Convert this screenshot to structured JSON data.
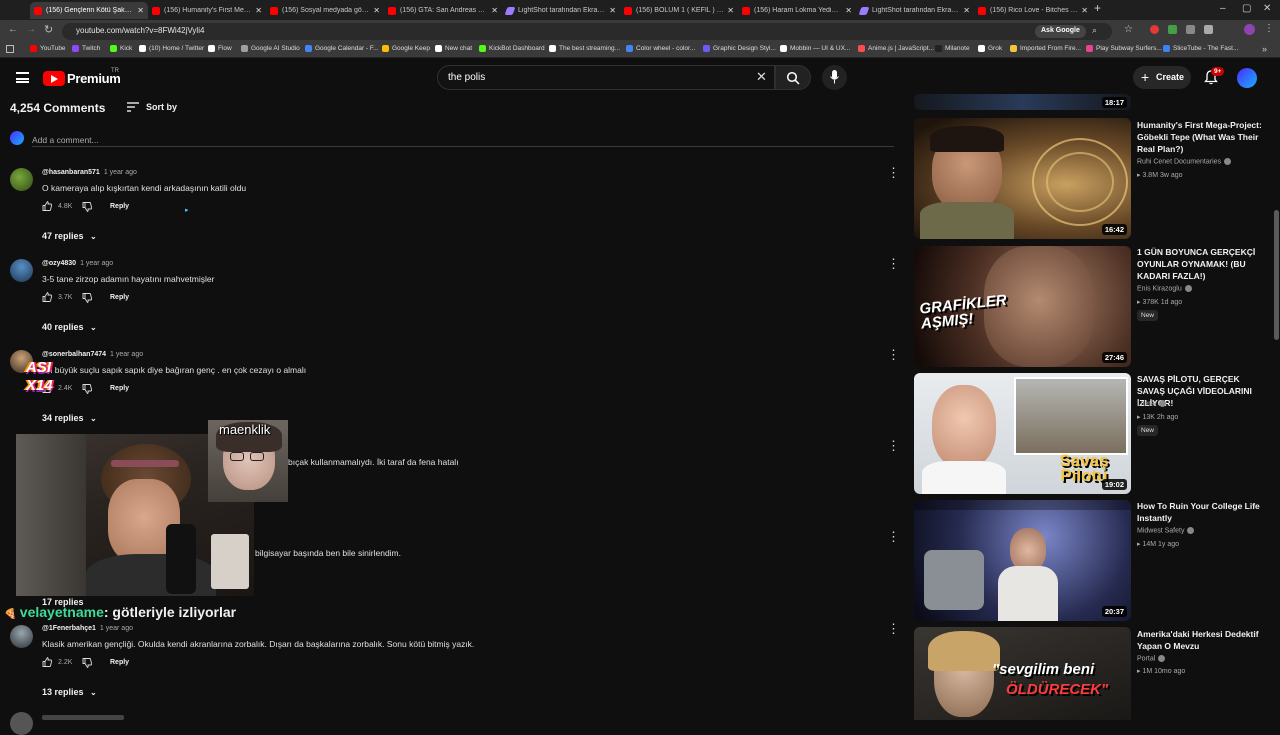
{
  "browser": {
    "tabs": [
      {
        "label": "(156) Gençlerin Kötü Şakası Cin",
        "type": "yt"
      },
      {
        "label": "(156) Humanity's First Mega-Pr",
        "type": "yt"
      },
      {
        "label": "(156) Sosyal medyada gösteriş",
        "type": "yt"
      },
      {
        "label": "(156) GTA: San Andreas Türkçe",
        "type": "yt"
      },
      {
        "label": "LightShot tarafından Ekran Gör",
        "type": "ls"
      },
      {
        "label": "(156) BÖLÜM 1 ( KEFİL ) - YouTu",
        "type": "yt"
      },
      {
        "label": "(156) Haram Lokma Yedinmi H",
        "type": "yt"
      },
      {
        "label": "LightShot tarafından Ekran Gör",
        "type": "ls"
      },
      {
        "label": "(156) Rico Love - Bitches Be Lik",
        "type": "yt"
      }
    ],
    "url": "youtube.com/watch?v=8FWi42jVyli4",
    "ask_google": "Ask Google",
    "bookmarks": [
      {
        "label": "YouTube",
        "color": "#ff0000"
      },
      {
        "label": "Twitch",
        "color": "#9146ff"
      },
      {
        "label": "Kick",
        "color": "#53fc18"
      },
      {
        "label": "(10) Home / Twitter",
        "color": "#ffffff"
      },
      {
        "label": "Flow",
        "color": "#ffffff"
      },
      {
        "label": "Google AI Studio",
        "color": "#9aa0a6"
      },
      {
        "label": "Google Calendar - F...",
        "color": "#4285f4"
      },
      {
        "label": "Google Keep",
        "color": "#fbbc04"
      },
      {
        "label": "New chat",
        "color": "#ffffff"
      },
      {
        "label": "KickBot Dashboard",
        "color": "#53fc18"
      },
      {
        "label": "The best streaming...",
        "color": "#ffffff"
      },
      {
        "label": "Color wheel - color...",
        "color": "#4285f4"
      },
      {
        "label": "Graphic Design Styl...",
        "color": "#6b5bff"
      },
      {
        "label": "Mobbin — UI & UX...",
        "color": "#ffffff"
      },
      {
        "label": "Anime.js | JavaScript...",
        "color": "#ff4b4b"
      },
      {
        "label": "Milanote",
        "color": "#222222"
      },
      {
        "label": "Grok",
        "color": "#ffffff"
      },
      {
        "label": "Imported From Fire...",
        "color": "#f7c33b"
      },
      {
        "label": "Play Subway Surfers...",
        "color": "#e84393"
      },
      {
        "label": "SliceTube - The Fast...",
        "color": "#3b82f6"
      }
    ]
  },
  "header": {
    "logo_text": "Premium",
    "logo_region": "TR",
    "search_value": "the polis",
    "create_label": "Create",
    "notif_count": "9+"
  },
  "comments_header": {
    "count": "4,254 Comments",
    "sort_label": "Sort by",
    "add_placeholder": "Add a comment..."
  },
  "comments": [
    {
      "author": "@hasanbaran571",
      "time": "1 year ago",
      "text": "O kameraya alıp kışkırtan kendi arkadaşının katili oldu",
      "likes": "4.8K",
      "reply": "Reply",
      "replies": "47 replies"
    },
    {
      "author": "@ozy4830",
      "time": "1 year ago",
      "text": "3-5 tane zirzop adamın hayatını mahvetmişler",
      "likes": "3.7K",
      "reply": "Reply",
      "replies": "40 replies"
    },
    {
      "author": "@sonerbalhan7474",
      "time": "1 year ago",
      "text": "En büyük suçlu sapık sapık diye bağıran genç . en çok cezayı o almalı",
      "likes": "2.4K",
      "reply": "Reply",
      "replies": "34 replies"
    },
    {
      "text": "bıçak kullanmamalıydı. İki taraf da fena hatalı"
    },
    {
      "text": "bilgisayar başında ben bile sinirlendim.",
      "replies": "17 replies"
    },
    {
      "author": "@1Fenerbahçe1",
      "time": "1 year ago",
      "text": "Klasik amerikan gençliği. Okulda kendi akranlarına zorbalık. Dışarı da başkalarına zorbalık. Sonu kötü bitmiş yazık.",
      "likes": "2.2K",
      "reply": "Reply",
      "replies": "13 replies"
    }
  ],
  "overlay": {
    "cam_name": "maenklik",
    "badge_text": "ASI X14",
    "chat_user": "velayetname",
    "chat_message": ": götleriyle izliyorlar"
  },
  "sidebar_videos": [
    {
      "duration": "18:17"
    },
    {
      "title": "Humanity's First Mega-Project: Göbekli Tepe (What Was Their Real Plan?)",
      "channel": "Ruhi Cenet Documentaries",
      "meta": "3.8M  3w ago",
      "duration": "16:42"
    },
    {
      "title": "1 GÜN BOYUNCA GERÇEKÇİ OYUNLAR OYNAMAK! (BU KADARI FAZLA!)",
      "channel": "Enis Kirazoglu",
      "meta": "378K  1d ago",
      "badge": "New",
      "duration": "27:46",
      "thumb_text": "GRAFİKLER AŞMIŞ!"
    },
    {
      "title": "SAVAŞ PİLOTU, GERÇEK SAVAŞ UÇAĞI VİDEOLARINI İZLİYOR!",
      "channel": "Literat",
      "meta": "13K  2h ago",
      "badge": "New",
      "duration": "19:02",
      "thumb_text": "Savaş Pilotu"
    },
    {
      "title": "How To Ruin Your College Life Instantly",
      "channel": "Midwest Safety",
      "meta": "14M  1y ago",
      "duration": "20:37"
    },
    {
      "title": "Amerika'daki Herkesi Dedektif Yapan O Mevzu",
      "channel": "Portal",
      "meta": "1M  10mo ago",
      "thumb_text_1": "\"sevgilim beni",
      "thumb_text_2": "ÖLDÜRECEK\""
    }
  ]
}
